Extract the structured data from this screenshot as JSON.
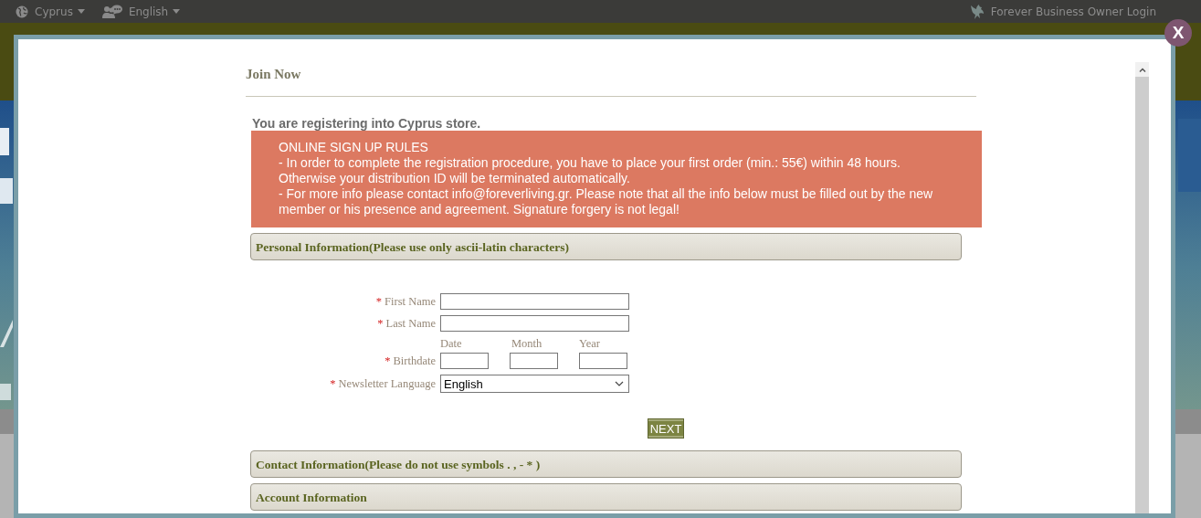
{
  "top_bar": {
    "country": "Cyprus",
    "language": "English",
    "login": "Forever Business Owner Login"
  },
  "dialog": {
    "close": "X",
    "title": "Join Now",
    "store_notice": "You are registering into Cyprus store.",
    "rules": {
      "heading": "ONLINE SIGN UP RULES",
      "items": [
        "- In order to complete the registration procedure, you have to place your first order (min.: 55€) within 48 hours. Otherwise your distribution ID will be terminated automatically.",
        "- For more info please contact info@foreverliving.gr. Please note that all the info below must be filled out by the new member or his presence and agreement. Signature forgery is not legal!"
      ]
    },
    "sections": [
      {
        "title": "Personal Information(Please use only ascii-latin characters)",
        "fields": [
          {
            "kind": "text",
            "label": "First Name",
            "required_mark": "*"
          },
          {
            "kind": "text",
            "label": "Last Name",
            "required_mark": "*"
          },
          {
            "kind": "date",
            "label": "Birthdate",
            "required_mark": "*",
            "parts": [
              "Date",
              "Month",
              "Year"
            ]
          },
          {
            "kind": "select",
            "label": "Newsletter Language",
            "required_mark": "*",
            "value": "English"
          }
        ],
        "button": "NEXT"
      },
      {
        "title": "Contact Information(Please do not use symbols . , - * )"
      },
      {
        "title": "Account Information"
      }
    ]
  }
}
